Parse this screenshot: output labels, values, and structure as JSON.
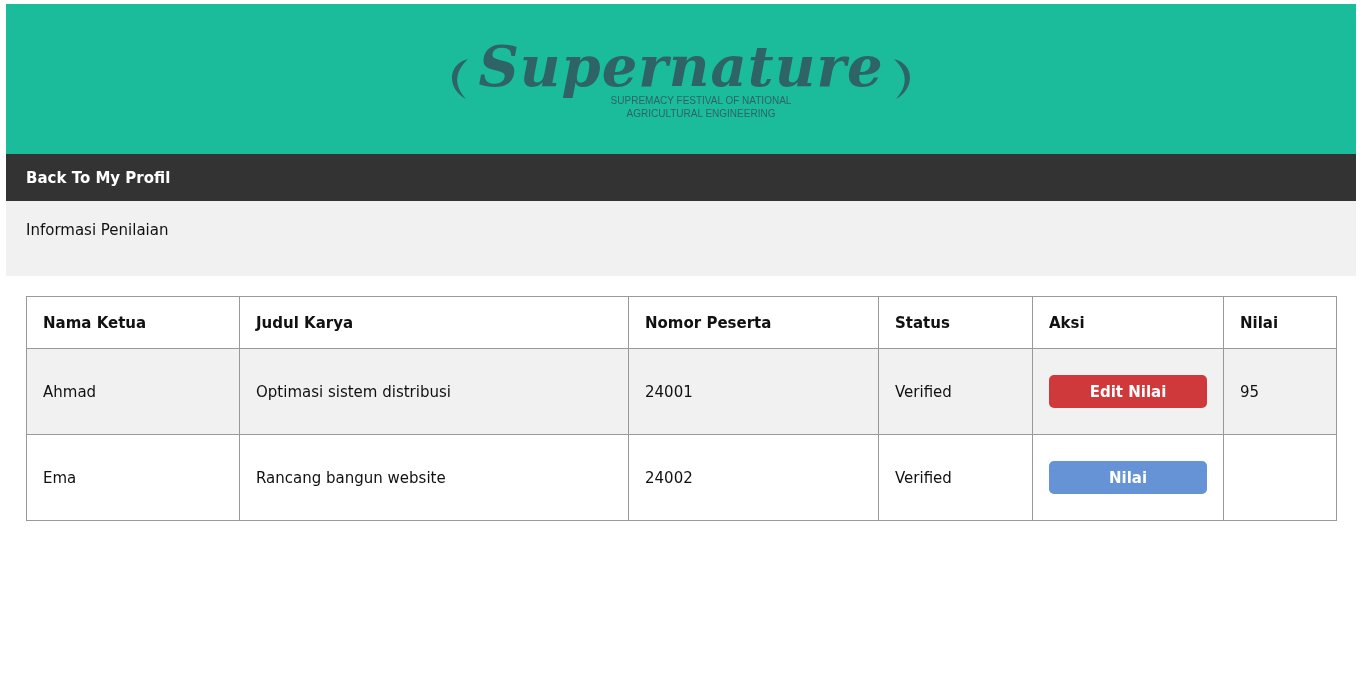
{
  "header": {
    "logo_title": "Supernature",
    "logo_tagline": [
      "SUPREMACY FESTIVAL OF NATIONAL",
      "AGRICULTURAL ENGINEERING"
    ]
  },
  "nav": {
    "link": "Back To My Profil"
  },
  "info": {
    "title": "Informasi Penilaian"
  },
  "table": {
    "columns": [
      "Nama Ketua",
      "Judul Karya",
      "Nomor Peserta",
      "Status",
      "Aksi",
      "Nilai"
    ],
    "rows": [
      {
        "name": "Ahmad",
        "title": "Optimasi sistem distribusi",
        "number": "24001",
        "status": "Verified",
        "action": {
          "kind": "edit",
          "label": "Edit Nilai"
        },
        "score": "95"
      },
      {
        "name": "Ema",
        "title": "Rancang bangun website",
        "number": "24002",
        "status": "Verified",
        "action": {
          "kind": "grade",
          "label": "Nilai"
        }
      }
    ]
  }
}
